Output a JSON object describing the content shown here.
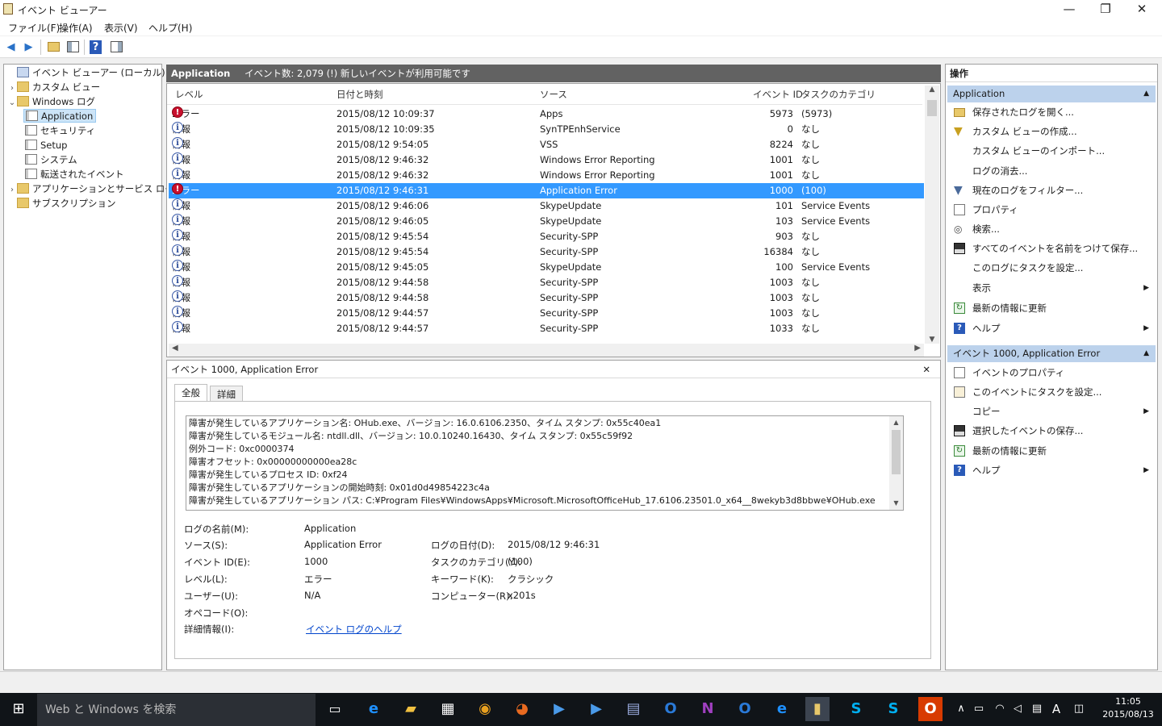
{
  "window": {
    "title": "イベント ビューアー",
    "min_glyph": "—",
    "max_glyph": "❐",
    "close_glyph": "✕"
  },
  "menu": [
    "ファイル(F)",
    "操作(A)",
    "表示(V)",
    "ヘルプ(H)"
  ],
  "toolbar": {
    "back": "◀",
    "forward": "▶",
    "help": "?"
  },
  "tree": {
    "root": "イベント ビューアー (ローカル)",
    "custom_views": "カスタム ビュー",
    "windows_logs": "Windows ログ",
    "logs": [
      "Application",
      "セキュリティ",
      "Setup",
      "システム",
      "転送されたイベント"
    ],
    "app_service_logs": "アプリケーションとサービス ログ",
    "subscriptions": "サブスクリプション"
  },
  "list": {
    "header_name": "Application",
    "header_info": "イベント数: 2,079 (!) 新しいイベントが利用可能です",
    "columns": [
      "レベル",
      "日付と時刻",
      "ソース",
      "イベント ID",
      "タスクのカテゴリ"
    ],
    "rows": [
      {
        "level": "エラー",
        "err": true,
        "dt": "2015/08/12 10:09:37",
        "src": "Apps",
        "id": "5973",
        "cat": "(5973)"
      },
      {
        "level": "情報",
        "dt": "2015/08/12 10:09:35",
        "src": "SynTPEnhService",
        "id": "0",
        "cat": "なし"
      },
      {
        "level": "情報",
        "dt": "2015/08/12 9:54:05",
        "src": "VSS",
        "id": "8224",
        "cat": "なし"
      },
      {
        "level": "情報",
        "dt": "2015/08/12 9:46:32",
        "src": "Windows Error Reporting",
        "id": "1001",
        "cat": "なし"
      },
      {
        "level": "情報",
        "dt": "2015/08/12 9:46:32",
        "src": "Windows Error Reporting",
        "id": "1001",
        "cat": "なし"
      },
      {
        "level": "エラー",
        "err": true,
        "selected": true,
        "dt": "2015/08/12 9:46:31",
        "src": "Application Error",
        "id": "1000",
        "cat": "(100)"
      },
      {
        "level": "情報",
        "dt": "2015/08/12 9:46:06",
        "src": "SkypeUpdate",
        "id": "101",
        "cat": "Service Events"
      },
      {
        "level": "情報",
        "dt": "2015/08/12 9:46:05",
        "src": "SkypeUpdate",
        "id": "103",
        "cat": "Service Events"
      },
      {
        "level": "情報",
        "dt": "2015/08/12 9:45:54",
        "src": "Security-SPP",
        "id": "903",
        "cat": "なし"
      },
      {
        "level": "情報",
        "dt": "2015/08/12 9:45:54",
        "src": "Security-SPP",
        "id": "16384",
        "cat": "なし"
      },
      {
        "level": "情報",
        "dt": "2015/08/12 9:45:05",
        "src": "SkypeUpdate",
        "id": "100",
        "cat": "Service Events"
      },
      {
        "level": "情報",
        "dt": "2015/08/12 9:44:58",
        "src": "Security-SPP",
        "id": "1003",
        "cat": "なし"
      },
      {
        "level": "情報",
        "dt": "2015/08/12 9:44:58",
        "src": "Security-SPP",
        "id": "1003",
        "cat": "なし"
      },
      {
        "level": "情報",
        "dt": "2015/08/12 9:44:57",
        "src": "Security-SPP",
        "id": "1003",
        "cat": "なし"
      },
      {
        "level": "情報",
        "dt": "2015/08/12 9:44:57",
        "src": "Security-SPP",
        "id": "1033",
        "cat": "なし"
      }
    ]
  },
  "detail": {
    "title": "イベント 1000, Application Error",
    "tabs": [
      "全般",
      "詳細"
    ],
    "text": [
      "障害が発生しているアプリケーション名: OHub.exe、バージョン: 16.0.6106.2350、タイム スタンプ: 0x55c40ea1",
      "障害が発生しているモジュール名: ntdll.dll、バージョン: 10.0.10240.16430、タイム スタンプ: 0x55c59f92",
      "例外コード: 0xc0000374",
      "障害オフセット: 0x00000000000ea28c",
      "障害が発生しているプロセス ID: 0xf24",
      "障害が発生しているアプリケーションの開始時刻: 0x01d0d49854223c4a",
      "障害が発生しているアプリケーション パス: C:¥Program Files¥WindowsApps¥Microsoft.MicrosoftOfficeHub_17.6106.23501.0_x64__8wekyb3d8bbwe¥OHub.exe"
    ],
    "props": {
      "log_name_lbl": "ログの名前(M):",
      "log_name": "Application",
      "source_lbl": "ソース(S):",
      "source": "Application Error",
      "logged_lbl": "ログの日付(D):",
      "logged": "2015/08/12 9:46:31",
      "event_id_lbl": "イベント ID(E):",
      "event_id": "1000",
      "task_lbl": "タスクのカテゴリ(Y):",
      "task": "(100)",
      "level_lbl": "レベル(L):",
      "level": "エラー",
      "keywords_lbl": "キーワード(K):",
      "keywords": "クラシック",
      "user_lbl": "ユーザー(U):",
      "user": "N/A",
      "computer_lbl": "コンピューター(R):",
      "computer": "x201s",
      "opcode_lbl": "オペコード(O):",
      "more_lbl": "詳細情報(I):",
      "more_link": "イベント ログのヘルプ"
    }
  },
  "actions": {
    "title": "操作",
    "section1": "Application",
    "items1": [
      "保存されたログを開く...",
      "カスタム ビューの作成...",
      "カスタム ビューのインポート...",
      "ログの消去...",
      "現在のログをフィルター...",
      "プロパティ",
      "検索...",
      "すべてのイベントを名前をつけて保存...",
      "このログにタスクを設定...",
      "表示",
      "最新の情報に更新",
      "ヘルプ"
    ],
    "section2": "イベント 1000, Application Error",
    "items2": [
      "イベントのプロパティ",
      "このイベントにタスクを設定...",
      "コピー",
      "選択したイベントの保存...",
      "最新の情報に更新",
      "ヘルプ"
    ]
  },
  "taskbar": {
    "search_placeholder": "Web と Windows を検索",
    "time": "11:05",
    "date": "2015/08/13",
    "ime": "A"
  },
  "colors": {
    "selection": "#3399ff",
    "header_strip": "#626262",
    "action_header": "#bcd2ec",
    "taskbar": "#101418",
    "error": "#c8102e"
  }
}
